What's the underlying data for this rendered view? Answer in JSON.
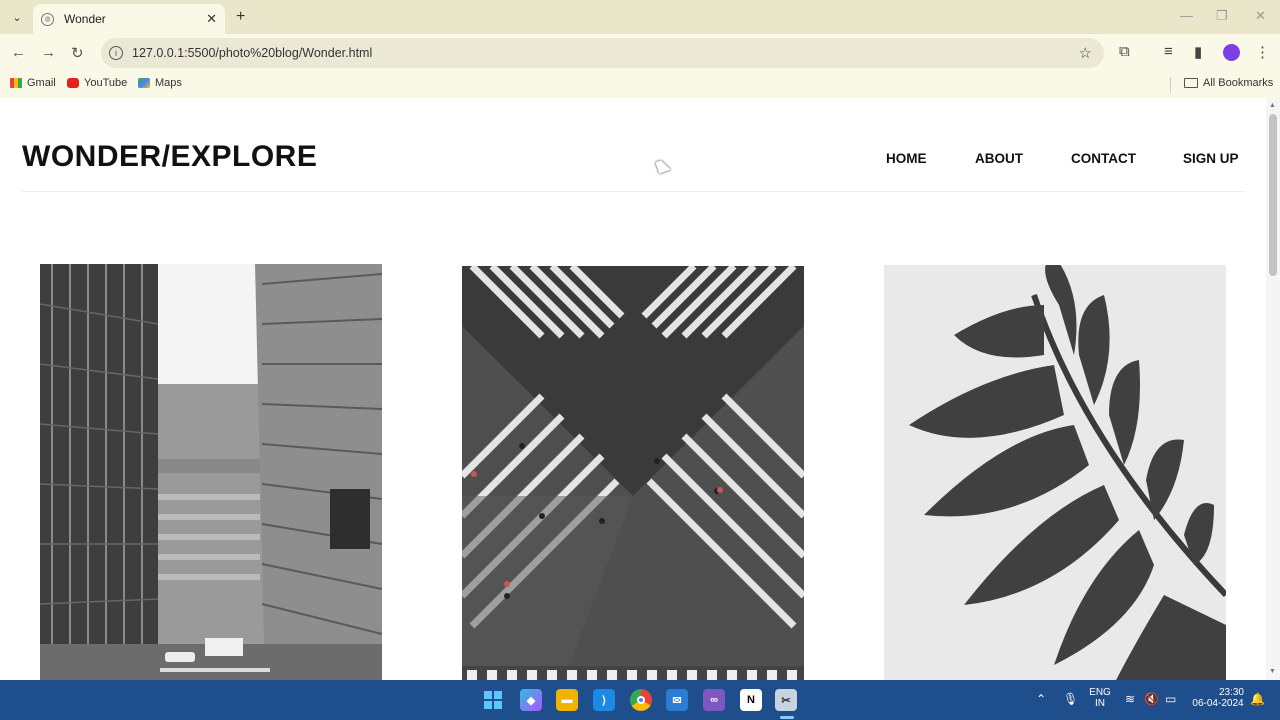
{
  "browser": {
    "tab_title": "Wonder",
    "url": "127.0.0.1:5500/photo%20blog/Wonder.html",
    "bookmarks": [
      "Gmail",
      "YouTube",
      "Maps"
    ],
    "all_bookmarks_label": "All Bookmarks"
  },
  "site": {
    "logo": "WONDER/EXPLORE",
    "nav": [
      "HOME",
      "ABOUT",
      "CONTACT",
      "SIGN UP"
    ]
  },
  "photos": [
    {
      "subject": "buildings"
    },
    {
      "subject": "crosswalk"
    },
    {
      "subject": "leaf"
    }
  ],
  "taskbar": {
    "lang_top": "ENG",
    "lang_bottom": "IN",
    "time": "23:30",
    "date": "06-04-2024"
  },
  "colors": {
    "taskbar": "#1f4e8c",
    "chrome_bar": "#faf8e6",
    "profile": "#7b3fe4"
  }
}
